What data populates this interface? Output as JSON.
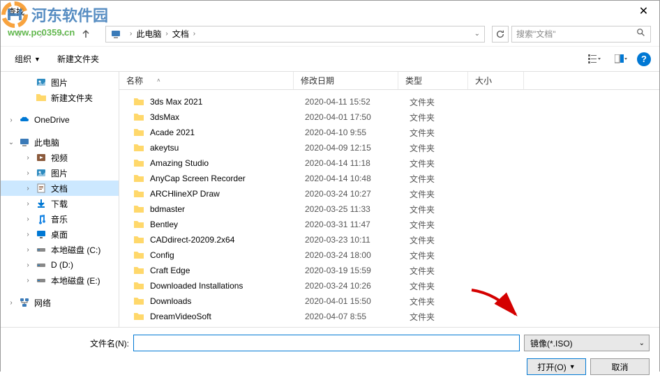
{
  "title": "查找",
  "watermark": {
    "brand": "河东软件园",
    "url": "www.pc0359.cn"
  },
  "breadcrumb": {
    "root": "此电脑",
    "current": "文档"
  },
  "search": {
    "placeholder": "搜索\"文档\""
  },
  "toolbar": {
    "organize": "组织",
    "new_folder": "新建文件夹"
  },
  "sidebar": {
    "items": [
      {
        "label": "图片",
        "icon": "image",
        "level": 2
      },
      {
        "label": "新建文件夹",
        "icon": "folder",
        "level": 2
      },
      {
        "label": "OneDrive",
        "icon": "onedrive",
        "level": 1,
        "exp": "›",
        "spacer": true
      },
      {
        "label": "此电脑",
        "icon": "pc",
        "level": 1,
        "exp": "⌄",
        "spacer": true
      },
      {
        "label": "视频",
        "icon": "video",
        "level": 2,
        "exp": "›"
      },
      {
        "label": "图片",
        "icon": "image",
        "level": 2,
        "exp": "›"
      },
      {
        "label": "文档",
        "icon": "doc",
        "level": 2,
        "exp": "›",
        "selected": true
      },
      {
        "label": "下载",
        "icon": "download",
        "level": 2,
        "exp": "›"
      },
      {
        "label": "音乐",
        "icon": "music",
        "level": 2,
        "exp": "›"
      },
      {
        "label": "桌面",
        "icon": "desktop",
        "level": 2,
        "exp": "›"
      },
      {
        "label": "本地磁盘 (C:)",
        "icon": "drive",
        "level": 2,
        "exp": "›"
      },
      {
        "label": "D (D:)",
        "icon": "drive",
        "level": 2,
        "exp": "›"
      },
      {
        "label": "本地磁盘 (E:)",
        "icon": "drive",
        "level": 2,
        "exp": "›"
      },
      {
        "label": "网络",
        "icon": "network",
        "level": 1,
        "exp": "›",
        "spacer": true
      }
    ]
  },
  "columns": {
    "name": "名称",
    "date": "修改日期",
    "type": "类型",
    "size": "大小"
  },
  "files": [
    {
      "name": "3ds Max 2021",
      "date": "2020-04-11 15:52",
      "type": "文件夹"
    },
    {
      "name": "3dsMax",
      "date": "2020-04-01 17:50",
      "type": "文件夹"
    },
    {
      "name": "Acade 2021",
      "date": "2020-04-10 9:55",
      "type": "文件夹"
    },
    {
      "name": "akeytsu",
      "date": "2020-04-09 12:15",
      "type": "文件夹"
    },
    {
      "name": "Amazing Studio",
      "date": "2020-04-14 11:18",
      "type": "文件夹"
    },
    {
      "name": "AnyCap Screen Recorder",
      "date": "2020-04-14 10:48",
      "type": "文件夹"
    },
    {
      "name": "ARCHlineXP Draw",
      "date": "2020-03-24 10:27",
      "type": "文件夹"
    },
    {
      "name": "bdmaster",
      "date": "2020-03-25 11:33",
      "type": "文件夹"
    },
    {
      "name": "Bentley",
      "date": "2020-03-31 11:47",
      "type": "文件夹"
    },
    {
      "name": "CADdirect-20209.2x64",
      "date": "2020-03-23 10:11",
      "type": "文件夹"
    },
    {
      "name": "Config",
      "date": "2020-03-24 18:00",
      "type": "文件夹"
    },
    {
      "name": "Craft Edge",
      "date": "2020-03-19 15:59",
      "type": "文件夹"
    },
    {
      "name": "Downloaded Installations",
      "date": "2020-03-24 10:26",
      "type": "文件夹"
    },
    {
      "name": "Downloads",
      "date": "2020-04-01 15:50",
      "type": "文件夹"
    },
    {
      "name": "DreamVideoSoft",
      "date": "2020-04-07 8:55",
      "type": "文件夹"
    }
  ],
  "footer": {
    "filename_label": "文件名(N):",
    "filename_value": "",
    "filetype": "镜像(*.ISO)",
    "open": "打开(O)",
    "cancel": "取消"
  }
}
